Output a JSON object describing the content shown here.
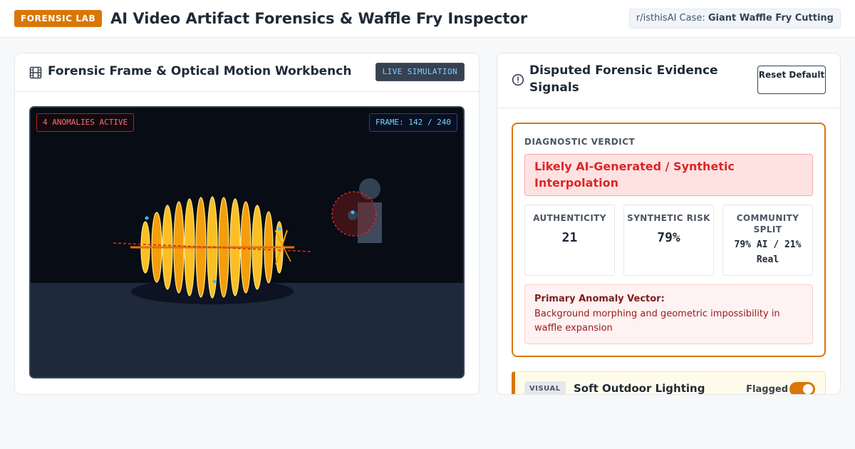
{
  "header": {
    "badge": "FORENSIC LAB",
    "title": "AI Video Artifact Forensics & Waffle Fry Inspector",
    "case_prefix": "r/isthisAI Case:",
    "case_name": "Giant Waffle Fry Cutting"
  },
  "workbench": {
    "title": "Forensic Frame & Optical Motion Workbench",
    "icon": "film-icon",
    "live_badge": "LIVE SIMULATION",
    "anomalies": "4 ANOMALIES ACTIVE",
    "frame": "FRAME: 142 / 240",
    "colors": {
      "fry": "#fbbf24",
      "fry_edge": "#d97706",
      "motion_line": "#dc2626",
      "artifact_dot": "#38bdf8",
      "ghost_ring": "#dc2626"
    }
  },
  "evidence": {
    "title": "Disputed Forensic Evidence Signals",
    "icon": "info-circle-icon",
    "reset_label": "Reset Default",
    "verdict_label": "DIAGNOSTIC VERDICT",
    "verdict": "Likely AI-Generated / Synthetic Interpolation",
    "metrics": [
      {
        "label": "AUTHENTICITY",
        "value": "21"
      },
      {
        "label": "SYNTHETIC RISK",
        "value": "79%"
      },
      {
        "label": "COMMUNITY SPLIT",
        "value": "79% AI / 21% Real"
      }
    ],
    "anomaly_title": "Primary Anomaly Vector:",
    "anomaly_text": "Background morphing and geometric impossibility in waffle expansion",
    "signal": {
      "tag": "VISUAL",
      "title": "Soft Outdoor Lighting",
      "flag": "Flagged",
      "enabled": true
    },
    "accent": "#d97706",
    "danger": "#dc2626"
  }
}
